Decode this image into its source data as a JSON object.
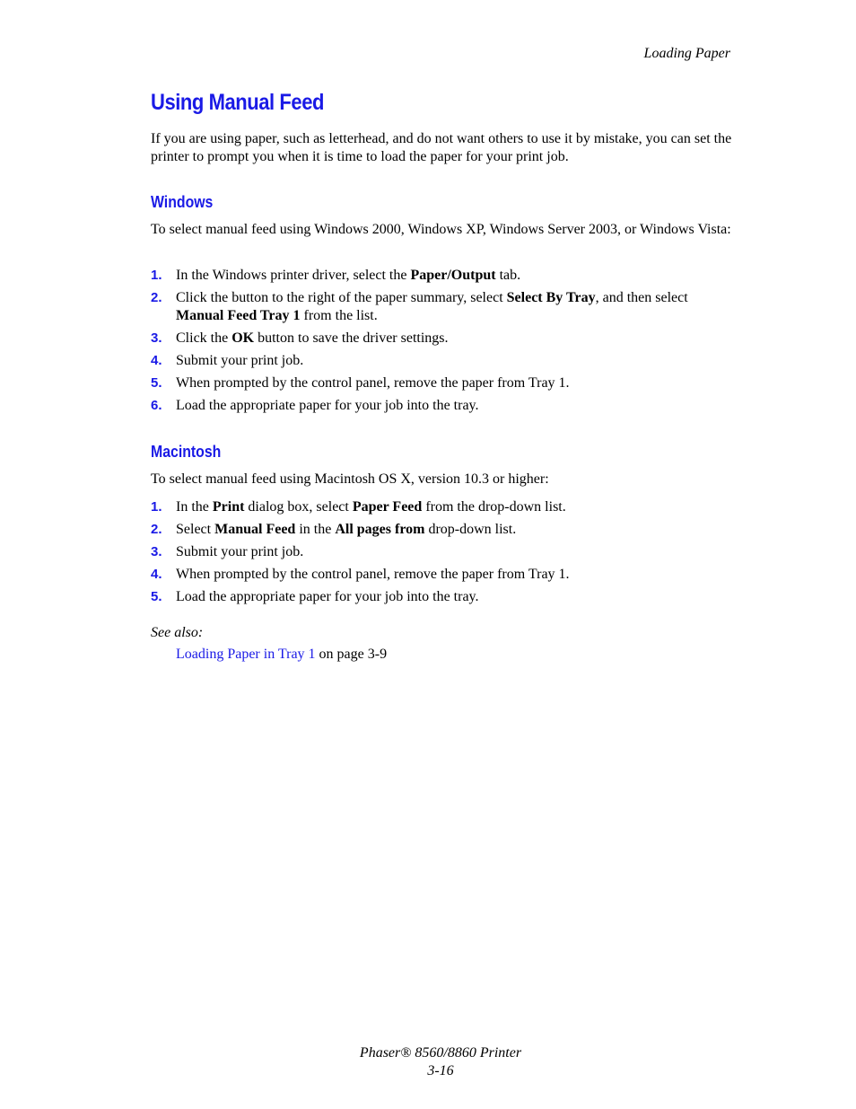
{
  "header": {
    "running_title": "Loading Paper"
  },
  "title": "Using Manual Feed",
  "intro": "If you are using paper, such as letterhead, and do not want others to use it by mistake, you can set the printer to prompt you when it is time to load the paper for your print job.",
  "windows": {
    "heading": "Windows",
    "intro": "To select manual feed using Windows 2000, Windows XP, Windows Server 2003, or Windows Vista:",
    "steps": [
      {
        "num": "1.",
        "parts": [
          "In the Windows printer driver, select the ",
          "Paper/Output",
          " tab."
        ]
      },
      {
        "num": "2.",
        "parts": [
          "Click the button to the right of the paper summary, select ",
          "Select By Tray",
          ", and then select ",
          "Manual Feed Tray 1",
          " from the list."
        ]
      },
      {
        "num": "3.",
        "parts": [
          "Click the ",
          "OK",
          " button to save the driver settings."
        ]
      },
      {
        "num": "4.",
        "text": "Submit your print job."
      },
      {
        "num": "5.",
        "text": "When prompted by the control panel, remove the paper from Tray 1."
      },
      {
        "num": "6.",
        "text": "Load the appropriate paper for your job into the tray."
      }
    ]
  },
  "macintosh": {
    "heading": "Macintosh",
    "intro": "To select manual feed using Macintosh OS X, version 10.3 or higher:",
    "steps": [
      {
        "num": "1.",
        "parts": [
          "In the ",
          "Print",
          " dialog box, select ",
          "Paper Feed",
          " from the drop-down list."
        ]
      },
      {
        "num": "2.",
        "parts": [
          "Select ",
          "Manual Feed",
          " in the ",
          "All pages from",
          " drop-down list."
        ]
      },
      {
        "num": "3.",
        "text": "Submit your print job."
      },
      {
        "num": "4.",
        "text": "When prompted by the control panel, remove the paper from Tray 1."
      },
      {
        "num": "5.",
        "text": "Load the appropriate paper for your job into the tray."
      }
    ]
  },
  "see_also": {
    "label": "See also:",
    "link_text": "Loading Paper in Tray 1",
    "suffix": " on page 3-9"
  },
  "footer": {
    "product": "Phaser® 8560/8860 Printer",
    "page_number": "3-16"
  }
}
